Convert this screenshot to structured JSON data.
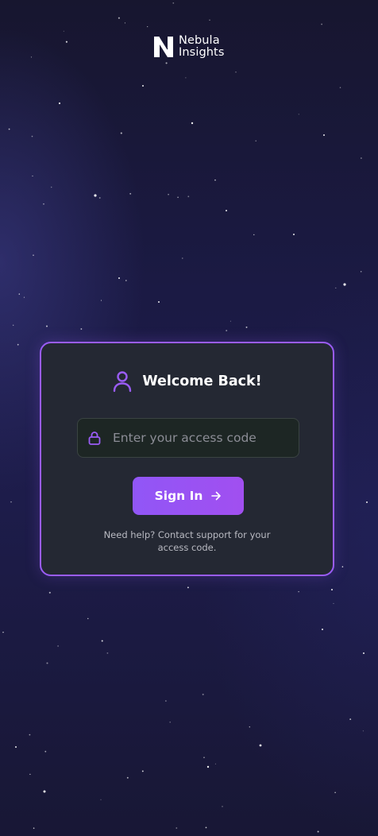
{
  "brand": {
    "line1": "Nebula",
    "line2": "Insights",
    "logo_icon": "n-monogram-icon"
  },
  "login_card": {
    "title": "Welcome Back!",
    "title_icon": "user-icon",
    "access_code": {
      "value": "",
      "placeholder": "Enter your access code",
      "icon": "lock-icon"
    },
    "sign_in_label": "Sign In",
    "sign_in_icon": "arrow-right-icon",
    "help_line1": "Need help? Contact support for your",
    "help_line2": "access code."
  },
  "colors": {
    "accent": "#9a5cf5",
    "button": "#9156f6",
    "card_background": "#242833",
    "page_background": "#1b1a44"
  }
}
